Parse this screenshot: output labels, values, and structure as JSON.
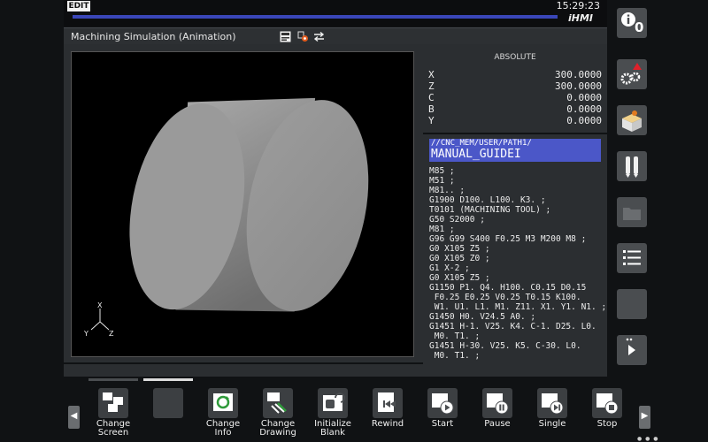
{
  "status": {
    "mode": "EDIT",
    "time": "15:29:23",
    "brand": "iHMI",
    "progress": 1.0
  },
  "screen": {
    "title": "Machining Simulation (Animation)",
    "title_icons": [
      "speed-icon",
      "record-icon",
      "swap-arrows-icon"
    ]
  },
  "simulation": {
    "axis_labels": {
      "x": "X",
      "y": "Y",
      "z": "Z"
    }
  },
  "coordinates": {
    "title": "ABSOLUTE",
    "rows": [
      {
        "axis": "X",
        "value": "300.0000"
      },
      {
        "axis": "Z",
        "value": "300.0000"
      },
      {
        "axis": "C",
        "value": "0.0000"
      },
      {
        "axis": "B",
        "value": "0.0000"
      },
      {
        "axis": "Y",
        "value": "0.0000"
      }
    ]
  },
  "program": {
    "path": "//CNC_MEM/USER/PATH1/",
    "name": "MANUAL_GUIDEI",
    "lines": [
      "M85 ;",
      "M51 ;",
      "M81.. ;",
      "G1900 D100. L100. K3. ;",
      "T0101 (MACHINING TOOL) ;",
      "G50 S2000 ;",
      "M81 ;",
      "G96 G99 S400 F0.25 M3 M200 M8 ;",
      "G0 X105 Z5 ;",
      "G0 X105 Z0 ;",
      "G1 X-2 ;",
      "G0 X105 Z5 ;",
      "G1150 P1. Q4. H100. C0.15 D0.15",
      " F0.25 E0.25 V0.25 T0.15 K100.",
      " W1. U1. L1. M1. Z11. X1. Y1. N1. ;",
      "G1450 H0. V24.5 A0. ;",
      "G1451 H-1. V25. K4. C-1. D25. L0.",
      " M0. T1. ;",
      "G1451 H-30. V25. K5. C-30. L0.",
      " M0. T1. ;"
    ]
  },
  "side_toolbar": [
    {
      "name": "info-icon",
      "badge": "0"
    },
    {
      "name": "settings-alarm-icon"
    },
    {
      "name": "tool-box-icon"
    },
    {
      "name": "tool-holders-icon"
    },
    {
      "name": "disabled-folder-icon"
    },
    {
      "name": "checklist-icon"
    },
    {
      "name": "blank-button"
    },
    {
      "name": "next-page-icon"
    }
  ],
  "softkeys": [
    {
      "id": "change-screen",
      "label": "Change\nScreen",
      "icon": "windows-icon"
    },
    {
      "id": "blank-1",
      "label": "",
      "icon": ""
    },
    {
      "id": "change-info",
      "label": "Change\nInfo",
      "icon": "info-swap-icon"
    },
    {
      "id": "change-drawing",
      "label": "Change\nDrawing",
      "icon": "drawing-swap-icon"
    },
    {
      "id": "initialize-blank",
      "label": "Initialize\nBlank",
      "icon": "blank-init-icon"
    },
    {
      "id": "rewind",
      "label": "Rewind",
      "icon": "rewind-icon"
    },
    {
      "id": "start",
      "label": "Start",
      "icon": "play-icon"
    },
    {
      "id": "pause",
      "label": "Pause",
      "icon": "pause-icon"
    },
    {
      "id": "single",
      "label": "Single",
      "icon": "single-step-icon"
    },
    {
      "id": "stop",
      "label": "Stop",
      "icon": "stop-icon"
    }
  ],
  "colors": {
    "accent": "#4b57c8",
    "panel": "#2b2e31",
    "background": "#101214"
  }
}
